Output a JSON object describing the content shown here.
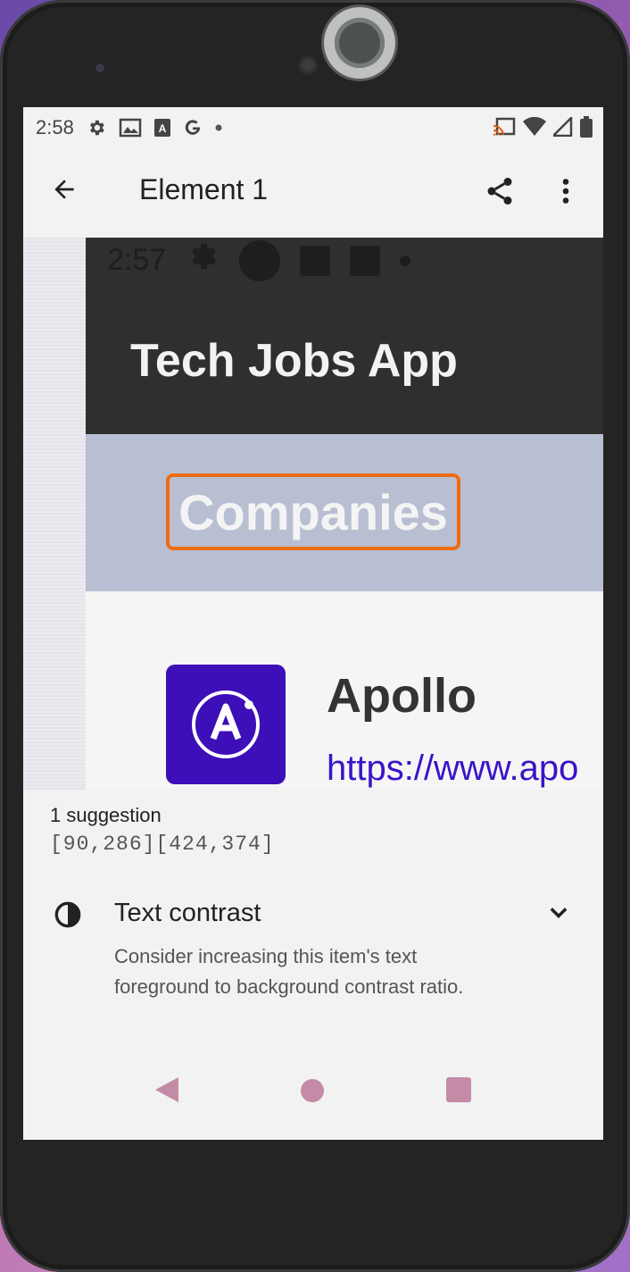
{
  "status_bar": {
    "time": "2:58"
  },
  "app_bar": {
    "title": "Element 1",
    "back_icon": "arrow-back-icon",
    "share_icon": "share-icon",
    "more_icon": "more-vert-icon"
  },
  "preview": {
    "ghost_time": "2:57",
    "app_title": "Tech Jobs App",
    "tab_label": "Companies",
    "company_name": "Apollo",
    "company_url": "https://www.apo",
    "highlight_color": "#ef6c12"
  },
  "suggestion": {
    "count_label": "1 suggestion",
    "bounds": "[90,286][424,374]",
    "title": "Text contrast",
    "description": "Consider increasing this item's text foreground to background contrast ratio."
  }
}
